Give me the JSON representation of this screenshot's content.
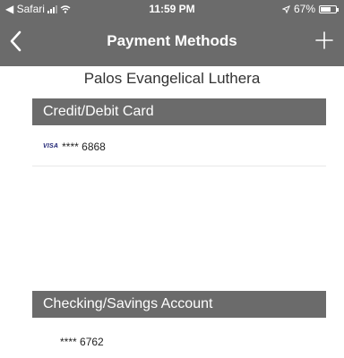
{
  "status_bar": {
    "back_app": "◀ Safari",
    "time": "11:59 PM",
    "battery": "67%",
    "battery_level": 0.67
  },
  "navbar": {
    "title": "Payment Methods",
    "back_icon": "chevron-left-icon",
    "add_icon": "plus-icon"
  },
  "organization": {
    "name": "Palos Evangelical Luthera"
  },
  "sections": {
    "cards": {
      "title": "Credit/Debit Card",
      "items": [
        {
          "brand": "VISA",
          "masked_number": "**** 6868"
        }
      ]
    },
    "bank_accounts": {
      "title": "Checking/Savings Account",
      "items": [
        {
          "masked_number": "**** 6762"
        }
      ]
    }
  },
  "colors": {
    "header_gray": "#6b6b6b",
    "visa_blue": "#1a1f71"
  }
}
